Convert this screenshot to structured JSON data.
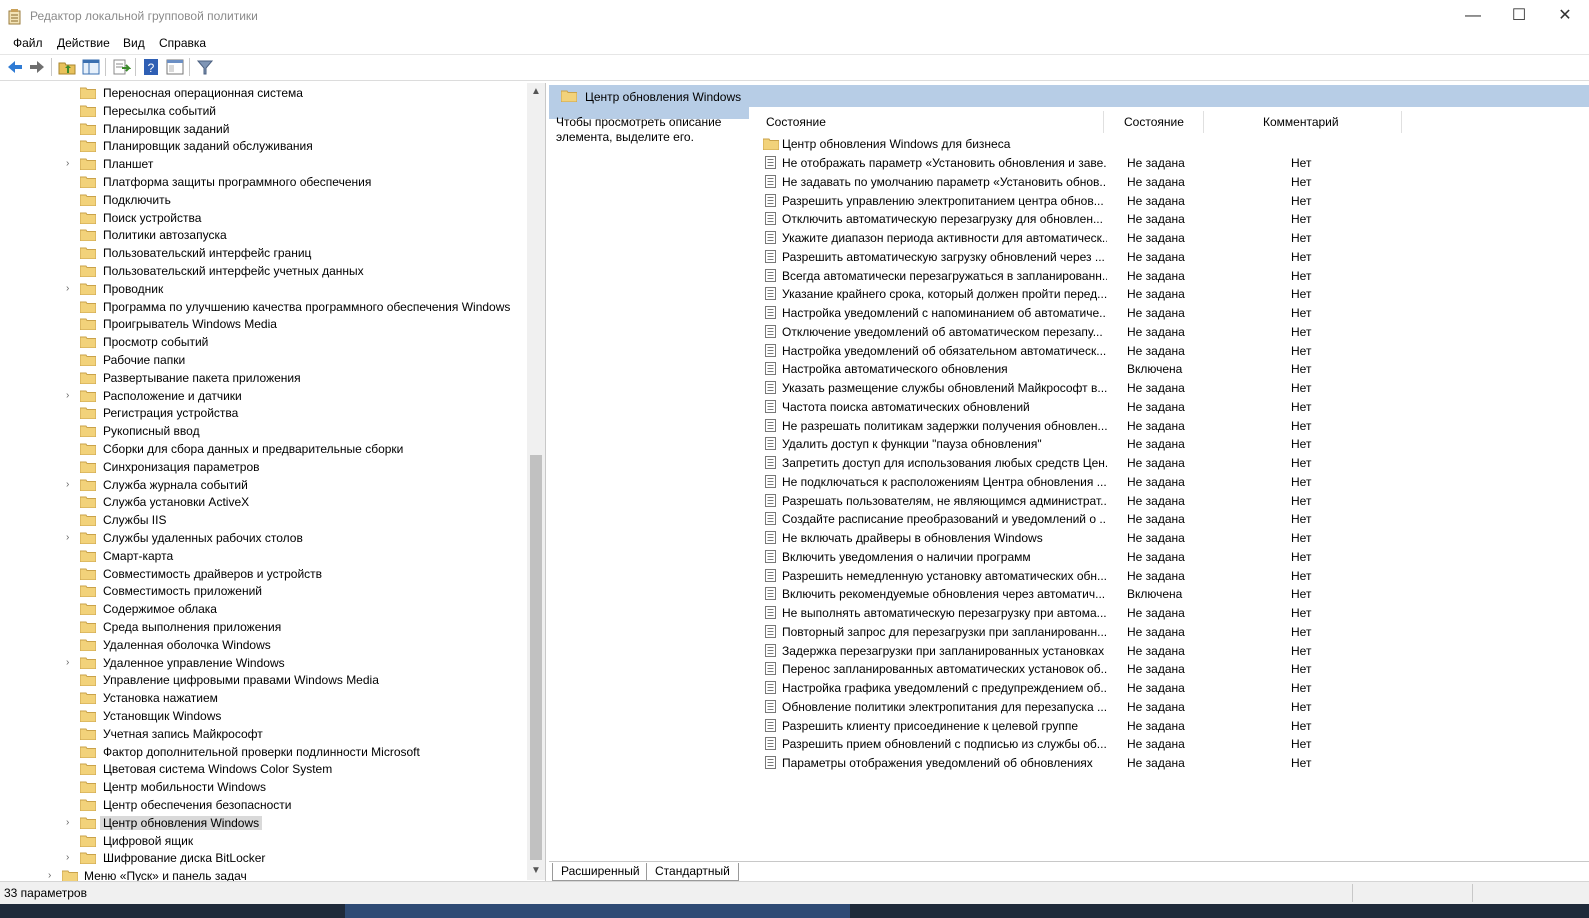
{
  "window": {
    "title": "Редактор локальной групповой политики"
  },
  "menu": [
    "Файл",
    "Действие",
    "Вид",
    "Справка"
  ],
  "toolbar_icons": [
    "back-icon",
    "forward-icon",
    "up-folder-icon",
    "show-hide-tree-icon",
    "export-list-icon",
    "help-icon",
    "properties-icon",
    "filter-icon"
  ],
  "tree": {
    "items": [
      {
        "label": "Переносная операционная система",
        "expandable": false
      },
      {
        "label": "Пересылка событий",
        "expandable": false
      },
      {
        "label": "Планировщик заданий",
        "expandable": false
      },
      {
        "label": "Планировщик заданий обслуживания",
        "expandable": false
      },
      {
        "label": "Планшет",
        "expandable": true
      },
      {
        "label": "Платформа защиты программного обеспечения",
        "expandable": false
      },
      {
        "label": "Подключить",
        "expandable": false
      },
      {
        "label": "Поиск устройства",
        "expandable": false
      },
      {
        "label": "Политики автозапуска",
        "expandable": false
      },
      {
        "label": "Пользовательский интерфейс границ",
        "expandable": false
      },
      {
        "label": "Пользовательский интерфейс учетных данных",
        "expandable": false
      },
      {
        "label": "Проводник",
        "expandable": true
      },
      {
        "label": "Программа по улучшению качества программного обеспечения Windows",
        "expandable": false
      },
      {
        "label": "Проигрыватель Windows Media",
        "expandable": false
      },
      {
        "label": "Просмотр событий",
        "expandable": false
      },
      {
        "label": "Рабочие папки",
        "expandable": false
      },
      {
        "label": "Развертывание пакета приложения",
        "expandable": false
      },
      {
        "label": "Расположение и датчики",
        "expandable": true
      },
      {
        "label": "Регистрация устройства",
        "expandable": false
      },
      {
        "label": "Рукописный ввод",
        "expandable": false
      },
      {
        "label": "Сборки для сбора данных и предварительные сборки",
        "expandable": false
      },
      {
        "label": "Синхронизация параметров",
        "expandable": false
      },
      {
        "label": "Служба журнала событий",
        "expandable": true
      },
      {
        "label": "Служба установки ActiveX",
        "expandable": false
      },
      {
        "label": "Службы IIS",
        "expandable": false
      },
      {
        "label": "Службы удаленных рабочих столов",
        "expandable": true
      },
      {
        "label": "Смарт-карта",
        "expandable": false
      },
      {
        "label": "Совместимость драйверов и устройств",
        "expandable": false
      },
      {
        "label": "Совместимость приложений",
        "expandable": false
      },
      {
        "label": "Содержимое облака",
        "expandable": false
      },
      {
        "label": "Среда выполнения приложения",
        "expandable": false
      },
      {
        "label": "Удаленная оболочка Windows",
        "expandable": false
      },
      {
        "label": "Удаленное управление Windows",
        "expandable": true
      },
      {
        "label": "Управление цифровыми правами Windows Media",
        "expandable": false
      },
      {
        "label": "Установка нажатием",
        "expandable": false
      },
      {
        "label": "Установщик Windows",
        "expandable": false
      },
      {
        "label": "Учетная запись Майкрософт",
        "expandable": false
      },
      {
        "label": "Фактор дополнительной проверки подлинности Microsoft",
        "expandable": false
      },
      {
        "label": "Цветовая система Windows Color System",
        "expandable": false
      },
      {
        "label": "Центр мобильности Windows",
        "expandable": false
      },
      {
        "label": "Центр обеспечения безопасности",
        "expandable": false
      },
      {
        "label": "Центр обновления Windows",
        "expandable": true,
        "selected": true
      },
      {
        "label": "Цифровой ящик",
        "expandable": false
      },
      {
        "label": "Шифрование диска BitLocker",
        "expandable": true
      }
    ],
    "partial_item": {
      "label": "Меню «Пуск» и панель задач",
      "expandable": true
    }
  },
  "right": {
    "header": "Центр обновления Windows",
    "description": "Чтобы просмотреть описание элемента, выделите его.",
    "columns": {
      "name": "Состояние",
      "state": "Состояние",
      "comment": "Комментарий"
    },
    "folder_row": "Центр обновления Windows для бизнеса",
    "rows": [
      {
        "name": "Не отображать параметр «Установить обновления и заве...",
        "state": "Не задана",
        "comment": "Нет"
      },
      {
        "name": "Не задавать по умолчанию параметр «Установить обнов...",
        "state": "Не задана",
        "comment": "Нет"
      },
      {
        "name": "Разрешить управлению электропитанием центра обнов...",
        "state": "Не задана",
        "comment": "Нет"
      },
      {
        "name": "Отключить автоматическую перезагрузку для обновлен...",
        "state": "Не задана",
        "comment": "Нет"
      },
      {
        "name": "Укажите диапазон периода активности для автоматическ...",
        "state": "Не задана",
        "comment": "Нет"
      },
      {
        "name": "Разрешить автоматическую загрузку обновлений через ...",
        "state": "Не задана",
        "comment": "Нет"
      },
      {
        "name": "Всегда автоматически перезагружаться в запланированн...",
        "state": "Не задана",
        "comment": "Нет"
      },
      {
        "name": "Указание крайнего срока, который должен пройти перед...",
        "state": "Не задана",
        "comment": "Нет"
      },
      {
        "name": "Настройка уведомлений с напоминанием об автоматиче...",
        "state": "Не задана",
        "comment": "Нет"
      },
      {
        "name": "Отключение уведомлений об автоматическом перезапу...",
        "state": "Не задана",
        "comment": "Нет"
      },
      {
        "name": "Настройка уведомлений об обязательном автоматическ...",
        "state": "Не задана",
        "comment": "Нет"
      },
      {
        "name": "Настройка автоматического обновления",
        "state": "Включена",
        "comment": "Нет"
      },
      {
        "name": "Указать размещение службы обновлений Майкрософт в...",
        "state": "Не задана",
        "comment": "Нет"
      },
      {
        "name": "Частота поиска автоматических обновлений",
        "state": "Не задана",
        "comment": "Нет"
      },
      {
        "name": "Не разрешать политикам задержки получения обновлен...",
        "state": "Не задана",
        "comment": "Нет"
      },
      {
        "name": "Удалить доступ к функции \"пауза обновления\"",
        "state": "Не задана",
        "comment": "Нет"
      },
      {
        "name": "Запретить доступ для использования любых средств Цен...",
        "state": "Не задана",
        "comment": "Нет"
      },
      {
        "name": "Не подключаться к расположениям Центра обновления ...",
        "state": "Не задана",
        "comment": "Нет"
      },
      {
        "name": "Разрешать пользователям, не являющимся администрат...",
        "state": "Не задана",
        "comment": "Нет"
      },
      {
        "name": "Создайте расписание преобразований и уведомлений о ...",
        "state": "Не задана",
        "comment": "Нет"
      },
      {
        "name": "Не включать драйверы в обновления Windows",
        "state": "Не задана",
        "comment": "Нет"
      },
      {
        "name": "Включить уведомления о наличии программ",
        "state": "Не задана",
        "comment": "Нет"
      },
      {
        "name": "Разрешить немедленную установку автоматических обн...",
        "state": "Не задана",
        "comment": "Нет"
      },
      {
        "name": "Включить рекомендуемые обновления через автоматич...",
        "state": "Включена",
        "comment": "Нет"
      },
      {
        "name": "Не выполнять автоматическую перезагрузку при автома...",
        "state": "Не задана",
        "comment": "Нет"
      },
      {
        "name": "Повторный запрос для перезагрузки при запланированн...",
        "state": "Не задана",
        "comment": "Нет"
      },
      {
        "name": "Задержка перезагрузки при запланированных установках",
        "state": "Не задана",
        "comment": "Нет"
      },
      {
        "name": "Перенос запланированных автоматических установок об...",
        "state": "Не задана",
        "comment": "Нет"
      },
      {
        "name": "Настройка графика уведомлений с предупреждением об...",
        "state": "Не задана",
        "comment": "Нет"
      },
      {
        "name": "Обновление политики электропитания для перезапуска ...",
        "state": "Не задана",
        "comment": "Нет"
      },
      {
        "name": "Разрешить клиенту присоединение к целевой группе",
        "state": "Не задана",
        "comment": "Нет"
      },
      {
        "name": "Разрешить прием обновлений с подписью из службы об...",
        "state": "Не задана",
        "comment": "Нет"
      },
      {
        "name": "Параметры отображения уведомлений об обновлениях",
        "state": "Не задана",
        "comment": "Нет"
      }
    ],
    "tabs": [
      "Расширенный",
      "Стандартный"
    ]
  },
  "status": {
    "text": "33 параметров"
  }
}
